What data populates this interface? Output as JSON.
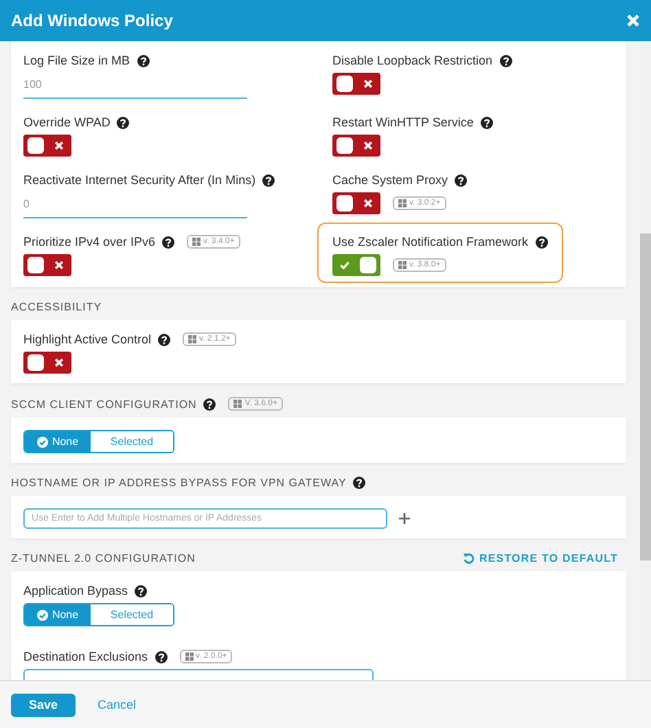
{
  "window": {
    "title": "Add Windows Policy"
  },
  "sections": [
    {
      "kind": "grid",
      "items": [
        {
          "kind": "number",
          "label": "Log File Size in MB",
          "help": true,
          "value": "100"
        },
        {
          "kind": "toggle",
          "label": "Disable Loopback Restriction",
          "help": true,
          "on": false
        },
        {
          "kind": "toggle",
          "label": "Override WPAD",
          "help": true,
          "on": false
        },
        {
          "kind": "toggle",
          "label": "Restart WinHTTP Service",
          "help": true,
          "on": false
        },
        {
          "kind": "number",
          "label": "Reactivate Internet Security After (In Mins)",
          "help": true,
          "value": "0"
        },
        {
          "kind": "toggle",
          "label": "Cache System Proxy",
          "help": true,
          "on": false,
          "version": "v. 3.0.2+",
          "version_inline": true
        },
        {
          "kind": "toggle",
          "label": "Prioritize IPv4 over IPv6",
          "help": true,
          "on": false,
          "version": "v. 3.4.0+"
        },
        {
          "kind": "toggle",
          "label": "Use Zscaler Notification Framework",
          "help": true,
          "on": true,
          "version": "v. 3.8.0+",
          "version_inline": true,
          "highlighted": true
        }
      ]
    },
    {
      "title": "ACCESSIBILITY",
      "kind": "stack",
      "items": [
        {
          "kind": "toggle",
          "label": "Highlight Active Control",
          "help": true,
          "on": false,
          "version": "v. 2.1.2+"
        }
      ]
    },
    {
      "title": "SCCM CLIENT CONFIGURATION",
      "help": true,
      "version": "V. 3.6.0+",
      "kind": "stack",
      "items": [
        {
          "kind": "segmented",
          "options": [
            {
              "label": "None",
              "selected": true
            },
            {
              "label": "Selected",
              "selected": false
            }
          ]
        }
      ]
    },
    {
      "title": "HOSTNAME OR IP ADDRESS BYPASS FOR VPN GATEWAY",
      "help": true,
      "kind": "stack",
      "items": [
        {
          "kind": "tags",
          "placeholder": "Use Enter to Add Multiple Hostnames or IP Addresses"
        }
      ]
    },
    {
      "title": "Z-TUNNEL 2.0 CONFIGURATION",
      "action": "RESTORE TO DEFAULT",
      "kind": "stack",
      "items": [
        {
          "kind": "segmented",
          "label": "Application Bypass",
          "help": true,
          "options": [
            {
              "label": "None",
              "selected": true
            },
            {
              "label": "Selected",
              "selected": false
            }
          ]
        },
        {
          "kind": "box",
          "label": "Destination Exclusions",
          "help": true,
          "version": "v. 2.0.0+"
        }
      ]
    }
  ],
  "footer": {
    "save": "Save",
    "cancel": "Cancel"
  }
}
